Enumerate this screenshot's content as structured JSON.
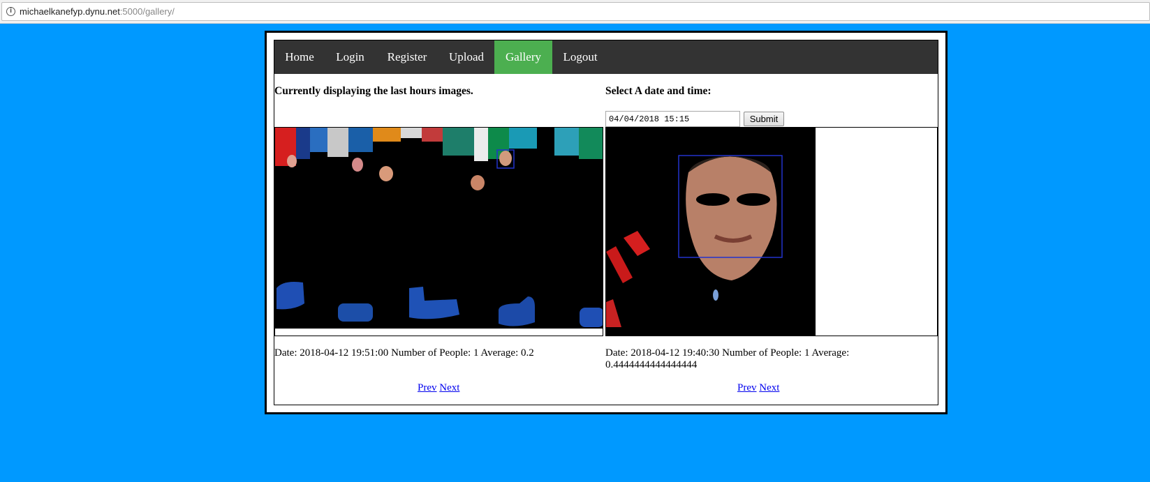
{
  "browser": {
    "url_host": "michaelkanefyp.dynu.net",
    "url_path": ":5000/gallery/"
  },
  "nav": {
    "items": [
      {
        "label": "Home",
        "active": false
      },
      {
        "label": "Login",
        "active": false
      },
      {
        "label": "Register",
        "active": false
      },
      {
        "label": "Upload",
        "active": false
      },
      {
        "label": "Gallery",
        "active": true
      },
      {
        "label": "Logout",
        "active": false
      }
    ]
  },
  "left": {
    "heading": "Currently displaying the last hours images.",
    "date_label": "Date:",
    "date_value": "2018-04-12 19:51:00",
    "people_label": "Number of People:",
    "people_value": "1",
    "average_label": "Average:",
    "average_value": "0.2",
    "prev": "Prev",
    "next": "Next"
  },
  "right": {
    "heading": "Select A date and time:",
    "datetime_value": "04/04/2018 15:15",
    "submit_label": "Submit",
    "date_label": "Date:",
    "date_value": "2018-04-12 19:40:30",
    "people_label": "Number of People:",
    "people_value": "1",
    "average_label": "Average:",
    "average_value": "0.4444444444444444",
    "prev": "Prev",
    "next": "Next"
  },
  "colors": {
    "page_bg": "#0099ff",
    "nav_bg": "#333333",
    "nav_active": "#4caf50",
    "link": "#0000ee"
  }
}
